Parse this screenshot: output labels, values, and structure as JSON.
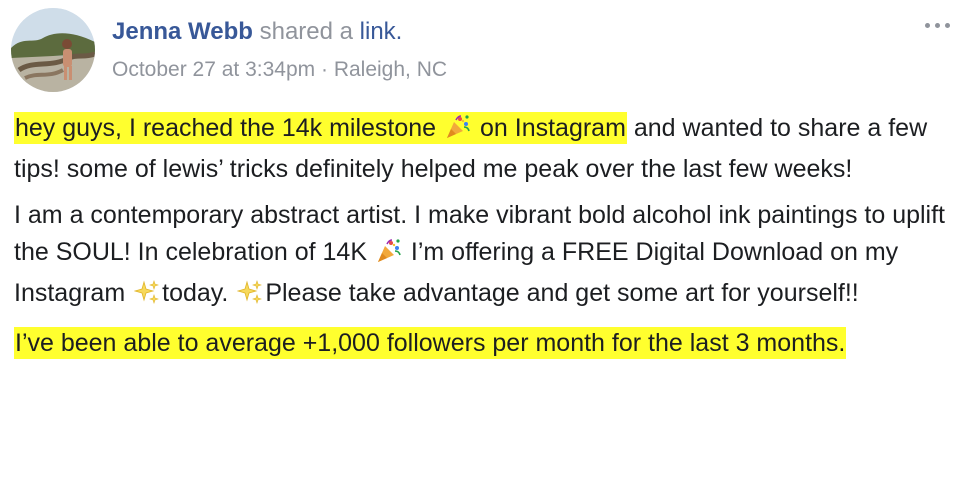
{
  "post": {
    "author": "Jenna Webb",
    "shared_verb": "shared a",
    "shared_object": "link.",
    "timestamp": "October 27 at 3:34pm",
    "separator": "·",
    "location": "Raleigh, NC",
    "more_label": "..."
  },
  "content": {
    "p1": {
      "hl_a": "hey guys, I reached the 14k milestone",
      "hl_b": "on Instagram",
      "rest": " and wanted to share a few tips! some of lewis’ tricks definitely helped me peak over the last few weeks!"
    },
    "p2": {
      "s1": "I am a contemporary abstract artist. I make vibrant bold alcohol ink paintings to uplift the SOUL! In celebration of 14K",
      "s2": " I’m offering a FREE Digital Download on my Instagram",
      "s3": "today.",
      "s4": "Please take advantage and get some art for yourself!!"
    },
    "p3": {
      "hl": "I’ve been able to average +1,000 followers per month for the last 3 months."
    }
  },
  "icons": {
    "party": "party-popper-icon",
    "sparkles": "sparkles-icon",
    "more": "more-options-icon"
  },
  "colors": {
    "link_blue": "#385898",
    "meta_gray": "#90949c",
    "text": "#1c1e21",
    "highlight": "#ffff2e"
  }
}
